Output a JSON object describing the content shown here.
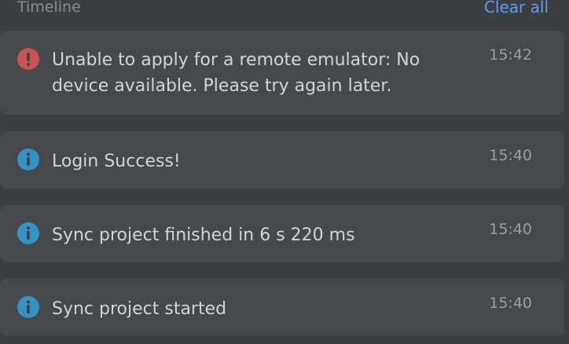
{
  "header": {
    "title": "Timeline",
    "clear_label": "Clear all"
  },
  "colors": {
    "error": "#c75450",
    "info": "#3592c4",
    "link": "#589df6"
  },
  "notifications": [
    {
      "icon": "error-icon",
      "message": "Unable to apply for a remote emulator: No device available. Please try again later.",
      "time": "15:42"
    },
    {
      "icon": "info-icon",
      "message": "Login Success!",
      "time": "15:40"
    },
    {
      "icon": "info-icon",
      "message": "Sync project finished in 6 s 220 ms",
      "time": "15:40"
    },
    {
      "icon": "info-icon",
      "message": "Sync project started",
      "time": "15:40"
    }
  ]
}
